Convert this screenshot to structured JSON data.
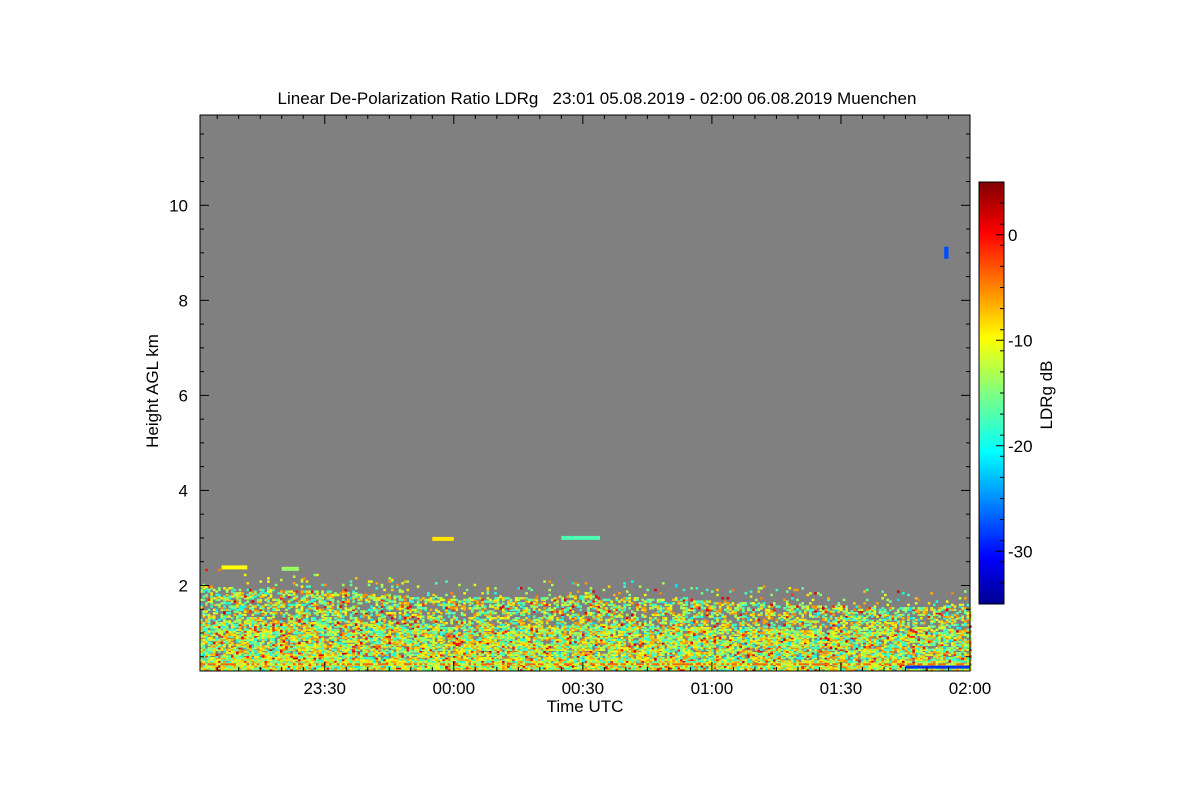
{
  "chart_data": {
    "type": "heatmap",
    "title": "Linear De-Polarization Ratio LDRg   23:01 05.08.2019 - 02:00 06.08.2019 Muenchen",
    "xlabel": "Time UTC",
    "ylabel": "Height AGL km",
    "colorbar_label": "LDRg dB",
    "x_start": "23:01",
    "x_end": "02:00",
    "xlim_minutes_from_2300": [
      1,
      180
    ],
    "ylim": [
      0.2,
      11.9
    ],
    "x_ticks": [
      {
        "label": "23:30",
        "minutes_from_2300": 30
      },
      {
        "label": "00:00",
        "minutes_from_2300": 60
      },
      {
        "label": "00:30",
        "minutes_from_2300": 90
      },
      {
        "label": "01:00",
        "minutes_from_2300": 120
      },
      {
        "label": "01:30",
        "minutes_from_2300": 150
      },
      {
        "label": "02:00",
        "minutes_from_2300": 180
      }
    ],
    "y_ticks": [
      {
        "label": "2",
        "value": 2
      },
      {
        "label": "4",
        "value": 4
      },
      {
        "label": "6",
        "value": 6
      },
      {
        "label": "8",
        "value": 8
      },
      {
        "label": "10",
        "value": 10
      }
    ],
    "colorbar": {
      "range": [
        -35,
        5
      ],
      "ticks": [
        {
          "label": "0",
          "value": 0
        },
        {
          "label": "-10",
          "value": -10
        },
        {
          "label": "-20",
          "value": -20
        },
        {
          "label": "-30",
          "value": -30
        }
      ],
      "colormap": "jet"
    },
    "background_color": "#808080",
    "aerosol_layer": {
      "top_km_by_time": [
        {
          "t": 1,
          "h": 2.0
        },
        {
          "t": 10,
          "h": 1.9
        },
        {
          "t": 30,
          "h": 1.85
        },
        {
          "t": 60,
          "h": 1.7
        },
        {
          "t": 90,
          "h": 1.75
        },
        {
          "t": 120,
          "h": 1.65
        },
        {
          "t": 150,
          "h": 1.55
        },
        {
          "t": 170,
          "h": 1.5
        },
        {
          "t": 180,
          "h": 1.6
        }
      ],
      "typical_ldr_db": -12
    },
    "features": [
      {
        "t_start": 6,
        "t_end": 12,
        "h": 2.38,
        "ldr_db": -10
      },
      {
        "t_start": 20,
        "t_end": 24,
        "h": 2.35,
        "ldr_db": -14
      },
      {
        "t_start": 55,
        "t_end": 60,
        "h": 2.98,
        "ldr_db": -9
      },
      {
        "t_start": 85,
        "t_end": 94,
        "h": 3.0,
        "ldr_db": -17
      },
      {
        "t_start": 174,
        "t_end": 175,
        "h": 9.0,
        "ldr_db": -27
      }
    ]
  }
}
